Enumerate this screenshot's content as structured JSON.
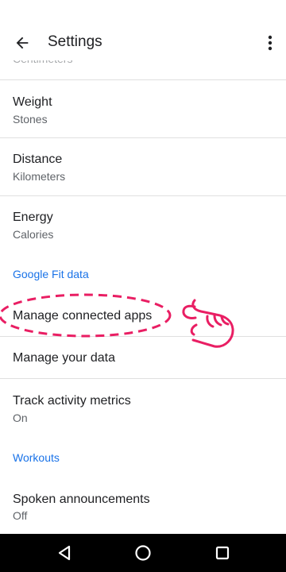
{
  "appbar": {
    "title": "Settings",
    "back_icon": "arrow-back-icon",
    "more_icon": "more-vert-icon"
  },
  "partial_item": {
    "subtitle": "Centimeters"
  },
  "units": [
    {
      "title": "Weight",
      "subtitle": "Stones"
    },
    {
      "title": "Distance",
      "subtitle": "Kilometers"
    },
    {
      "title": "Energy",
      "subtitle": "Calories"
    }
  ],
  "google_fit": {
    "header": "Google Fit data",
    "manage_apps": "Manage connected apps",
    "manage_data": "Manage your data",
    "track_title": "Track activity metrics",
    "track_value": "On"
  },
  "workouts": {
    "header": "Workouts",
    "spoken_title": "Spoken announcements",
    "spoken_value": "Off"
  },
  "navbar": {
    "back_icon": "nav-back-icon",
    "home_icon": "nav-home-icon",
    "recents_icon": "nav-recents-icon"
  },
  "colors": {
    "accent": "#1a73e8",
    "annotation": "#e91e63",
    "navbar_bg": "#000000"
  }
}
